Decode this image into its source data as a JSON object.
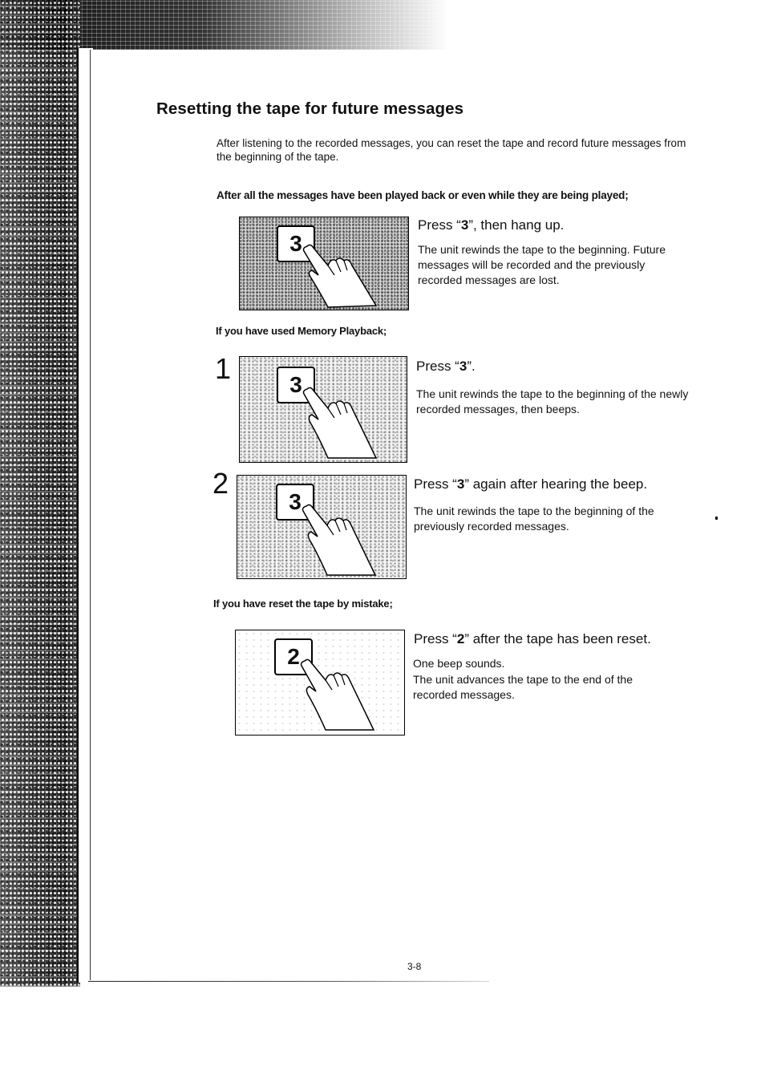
{
  "section": {
    "title": "Resetting the tape for future messages",
    "intro": "After listening to the recorded messages, you can reset the tape and record future messages from the beginning of the tape."
  },
  "blocks": [
    {
      "heading": "After all the messages have been played back or even while they are being played;",
      "steps": [
        {
          "number": "",
          "key": "3",
          "title_pre": "Press “",
          "title_key": "3",
          "title_post": "”, then hang up.",
          "body": "The unit rewinds the tape to the beginning. Future messages will be recorded and the previously recorded messages are lost."
        }
      ]
    },
    {
      "heading": "If you have used Memory Playback;",
      "steps": [
        {
          "number": "1",
          "key": "3",
          "title_pre": "Press “",
          "title_key": "3",
          "title_post": "”.",
          "body": "The unit rewinds the tape to the beginning of the newly recorded messages, then beeps."
        },
        {
          "number": "2",
          "key": "3",
          "title_pre": "Press “",
          "title_key": "3",
          "title_post": "” again after hearing the beep.",
          "body": "The unit rewinds the tape to the beginning of the previously recorded messages."
        }
      ]
    },
    {
      "heading": "If you have reset the tape by mistake;",
      "steps": [
        {
          "number": "",
          "key": "2",
          "title_pre": "Press “",
          "title_key": "2",
          "title_post": "” after the tape has been reset.",
          "body_line1": "One beep sounds.",
          "body": "The unit advances the tape to the end of the recorded messages."
        }
      ]
    }
  ],
  "footer": {
    "page_number": "3-8"
  },
  "icons": {
    "finger_press": "hand-pressing-key-icon"
  }
}
